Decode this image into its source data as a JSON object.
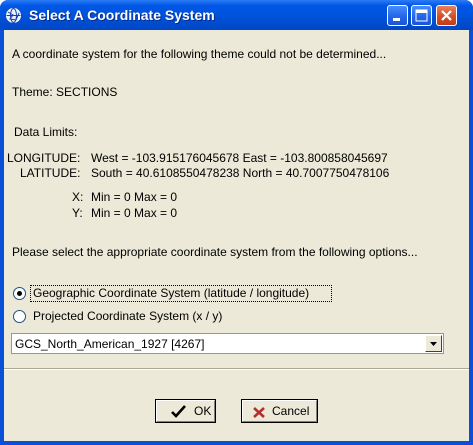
{
  "window": {
    "title": "Select A Coordinate System",
    "icon": "globe-icon"
  },
  "intro": "A coordinate system for the following theme could not be determined...",
  "theme": "Theme: SECTIONS",
  "data_limits_heading": "Data Limits:",
  "limits": {
    "longitude_label": "LONGITUDE:",
    "longitude_value": "West = -103.915176045678 East = -103.800858045697",
    "latitude_label": "LATITUDE:",
    "latitude_value": "South = 40.6108550478238 North = 40.7007750478106",
    "x_label": "X:",
    "x_value": "Min = 0 Max = 0",
    "y_label": "Y:",
    "y_value": "Min = 0 Max = 0"
  },
  "prompt": "Please select the appropriate coordinate system from the following options...",
  "options": {
    "geographic": {
      "label": "Geographic Coordinate System (latitude / longitude)",
      "selected": true
    },
    "projected": {
      "label": "Projected Coordinate System (x / y)",
      "selected": false
    }
  },
  "coordinate_select": {
    "value": "GCS_North_American_1927 [4267]"
  },
  "buttons": {
    "ok": "OK",
    "cancel": "Cancel"
  },
  "colors": {
    "titlebar": "#0058e6",
    "dialog_bg": "#ece9d8",
    "close_button": "#d5502a",
    "ok_check": "#000000",
    "cancel_x": "#b5302a"
  }
}
